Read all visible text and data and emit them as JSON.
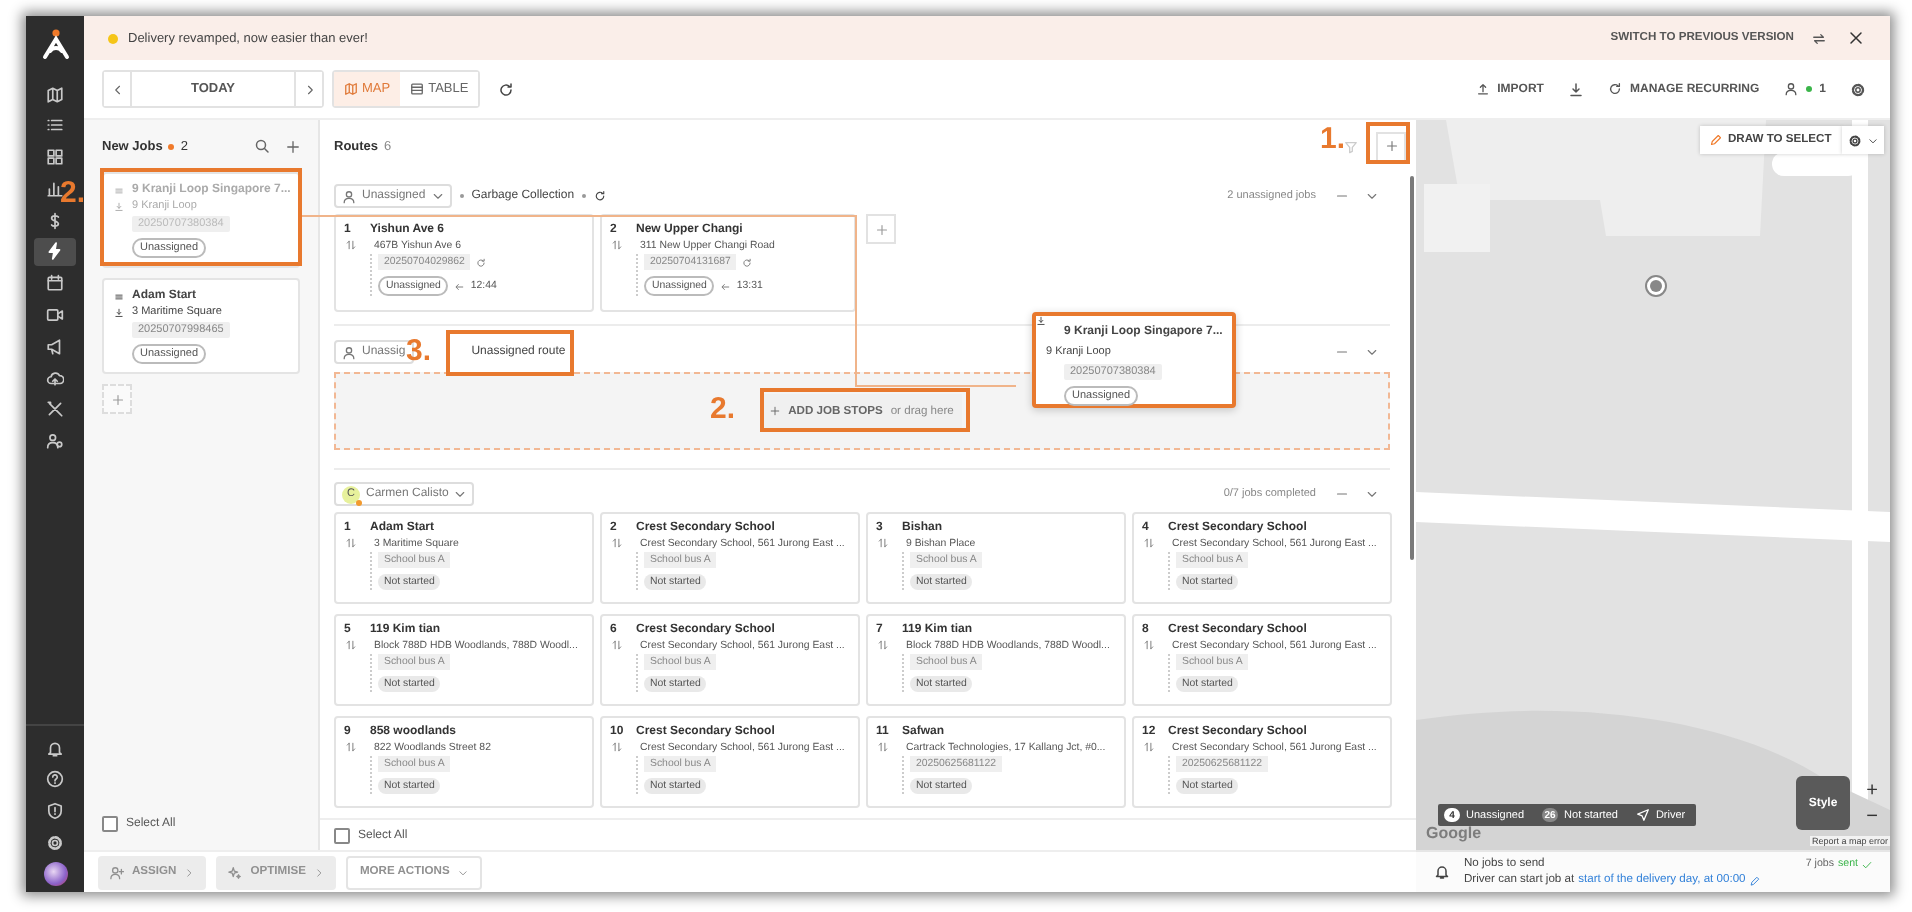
{
  "rail": {
    "top": [
      {
        "kind": "map",
        "selected": false
      },
      {
        "kind": "list",
        "selected": false
      },
      {
        "kind": "grid",
        "selected": false
      },
      {
        "kind": "chart",
        "selected": false
      },
      {
        "kind": "dollar",
        "selected": false
      },
      {
        "kind": "bolt",
        "selected": true
      },
      {
        "kind": "calendar",
        "selected": false
      },
      {
        "kind": "video",
        "selected": false
      },
      {
        "kind": "megaphone",
        "selected": false
      },
      {
        "kind": "cloud",
        "selected": false
      },
      {
        "kind": "tools",
        "selected": false
      },
      {
        "kind": "users",
        "selected": false
      }
    ],
    "bottom": [
      {
        "kind": "bell"
      },
      {
        "kind": "help"
      },
      {
        "kind": "shield"
      },
      {
        "kind": "gear"
      },
      {
        "kind": "avatar"
      }
    ]
  },
  "banner": {
    "message": "Delivery revamped, now easier than ever!",
    "switch_label": "SWITCH TO PREVIOUS VERSION"
  },
  "toolbar": {
    "date": "TODAY",
    "views": [
      {
        "kind": "map",
        "label": "MAP",
        "selected": true
      },
      {
        "kind": "table",
        "label": "TABLE",
        "selected": false
      }
    ],
    "actions": [
      {
        "kind": "import",
        "label": "IMPORT"
      },
      {
        "kind": "download"
      },
      {
        "kind": "recurring",
        "label": "MANAGE RECURRING"
      },
      {
        "kind": "users",
        "label": "1"
      },
      {
        "kind": "settings"
      }
    ]
  },
  "new_jobs": {
    "title": "New Jobs",
    "count": "2",
    "select_all": {
      "label": "Select All",
      "checked": false
    },
    "jobs": [
      {
        "title": "9 Kranji Loop Singapore 7...",
        "address": "9 Kranji Loop",
        "id": "20250707380384",
        "status": "Unassigned",
        "dragging": true
      },
      {
        "title": "Adam Start",
        "address": "3 Maritime Square",
        "id": "20250707998465",
        "status": "Unassigned",
        "dragging": false
      }
    ]
  },
  "routes": {
    "title": "Routes",
    "count": "6",
    "select_all": {
      "label": "Select All",
      "checked": false
    },
    "list": [
      {
        "kind": "stops",
        "assignee": "Unassigned",
        "type": "Garbage Collection",
        "summary": "2 unassigned jobs",
        "stops": [
          {
            "number": "1",
            "title": "Yishun Ave 6",
            "address": "467B Yishun Ave 6",
            "tag": "20250704029862",
            "recurring": true,
            "status": "Unassigned",
            "assigned": false,
            "time": "12:44"
          },
          {
            "number": "2",
            "title": "New Upper Changi",
            "address": "311 New Upper Changi Road",
            "tag": "20250704131687",
            "recurring": true,
            "status": "Unassigned",
            "assigned": false,
            "time": "13:31"
          }
        ]
      },
      {
        "kind": "empty",
        "assignee": "Unassig",
        "name": "Unassigned route",
        "add_label": "ADD JOB STOPS",
        "drop_hint": "or drag here"
      },
      {
        "kind": "stops",
        "assignee": "Carmen Calisto",
        "avatar": "C",
        "summary": "0/7 jobs completed",
        "stops": [
          {
            "number": "1",
            "title": "Adam Start",
            "address": "3 Maritime Square",
            "tag": "School bus A",
            "recurring": false,
            "status": "Not started",
            "assigned": true
          },
          {
            "number": "2",
            "title": "Crest Secondary School",
            "address": "Crest Secondary School, 561 Jurong East ...",
            "tag": "School bus A",
            "recurring": false,
            "status": "Not started",
            "assigned": true
          },
          {
            "number": "3",
            "title": "Bishan",
            "address": "9 Bishan Place",
            "tag": "School bus A",
            "recurring": false,
            "status": "Not started",
            "assigned": true
          },
          {
            "number": "4",
            "title": "Crest Secondary School",
            "address": "Crest Secondary School, 561 Jurong East ...",
            "tag": "School bus A",
            "recurring": false,
            "status": "Not started",
            "assigned": true
          },
          {
            "number": "5",
            "title": "119 Kim tian",
            "address": "Block 788D HDB Woodlands, 788D Woodl...",
            "tag": "School bus A",
            "recurring": false,
            "status": "Not started",
            "assigned": true
          },
          {
            "number": "6",
            "title": "Crest Secondary School",
            "address": "Crest Secondary School, 561 Jurong East ...",
            "tag": "School bus A",
            "recurring": false,
            "status": "Not started",
            "assigned": true
          },
          {
            "number": "7",
            "title": "119 Kim tian",
            "address": "Block 788D HDB Woodlands, 788D Woodl...",
            "tag": "School bus A",
            "recurring": false,
            "status": "Not started",
            "assigned": true
          },
          {
            "number": "8",
            "title": "Crest Secondary School",
            "address": "Crest Secondary School, 561 Jurong East ...",
            "tag": "School bus A",
            "recurring": false,
            "status": "Not started",
            "assigned": true
          },
          {
            "number": "9",
            "title": "858 woodlands",
            "address": "822 Woodlands Street 82",
            "tag": "School bus A",
            "recurring": false,
            "status": "Not started",
            "assigned": true
          },
          {
            "number": "10",
            "title": "Crest Secondary School",
            "address": "Crest Secondary School, 561 Jurong East ...",
            "tag": "School bus A",
            "recurring": false,
            "status": "Not started",
            "assigned": true
          },
          {
            "number": "11",
            "title": "Safwan",
            "address": "Cartrack Technologies, 17 Kallang Jct, #0...",
            "tag": "20250625681122",
            "recurring": false,
            "status": "Not started",
            "assigned": true
          },
          {
            "number": "12",
            "title": "Crest Secondary School",
            "address": "Crest Secondary School, 561 Jurong East ...",
            "tag": "20250625681122",
            "recurring": false,
            "status": "Not started",
            "assigned": true
          }
        ]
      }
    ]
  },
  "map": {
    "draw_label": "DRAW TO SELECT",
    "legend": [
      {
        "kind": "count",
        "count": "4",
        "label": "Unassigned"
      },
      {
        "kind": "count",
        "count": "26",
        "label": "Not started"
      },
      {
        "kind": "driver",
        "label": "Driver"
      }
    ],
    "style_label": "Style",
    "zoom_in": "+",
    "zoom_out": "−",
    "attribution": "Google",
    "report": "Report a map error"
  },
  "bottom": {
    "actions": [
      {
        "kind": "assign",
        "label": "ASSIGN",
        "disabled": true
      },
      {
        "kind": "optimise",
        "label": "OPTIMISE",
        "disabled": true
      },
      {
        "kind": "more",
        "label": "MORE ACTIONS",
        "disabled": true
      }
    ],
    "notice": {
      "title": "No jobs to send",
      "text": "Driver can start job at",
      "link": "start of the delivery day, at 00:00",
      "sent_count": "7 jobs",
      "sent_label": "sent"
    }
  },
  "annotations": [
    {
      "kind": "add_route",
      "label": "1."
    },
    {
      "kind": "new_job",
      "label": "2."
    },
    {
      "kind": "add_stops",
      "label": "2."
    },
    {
      "kind": "route_name",
      "label": "3."
    }
  ],
  "dragged_card": {
    "title": "9 Kranji Loop Singapore 7...",
    "address": "9 Kranji Loop",
    "id": "20250707380384",
    "status": "Unassigned"
  }
}
